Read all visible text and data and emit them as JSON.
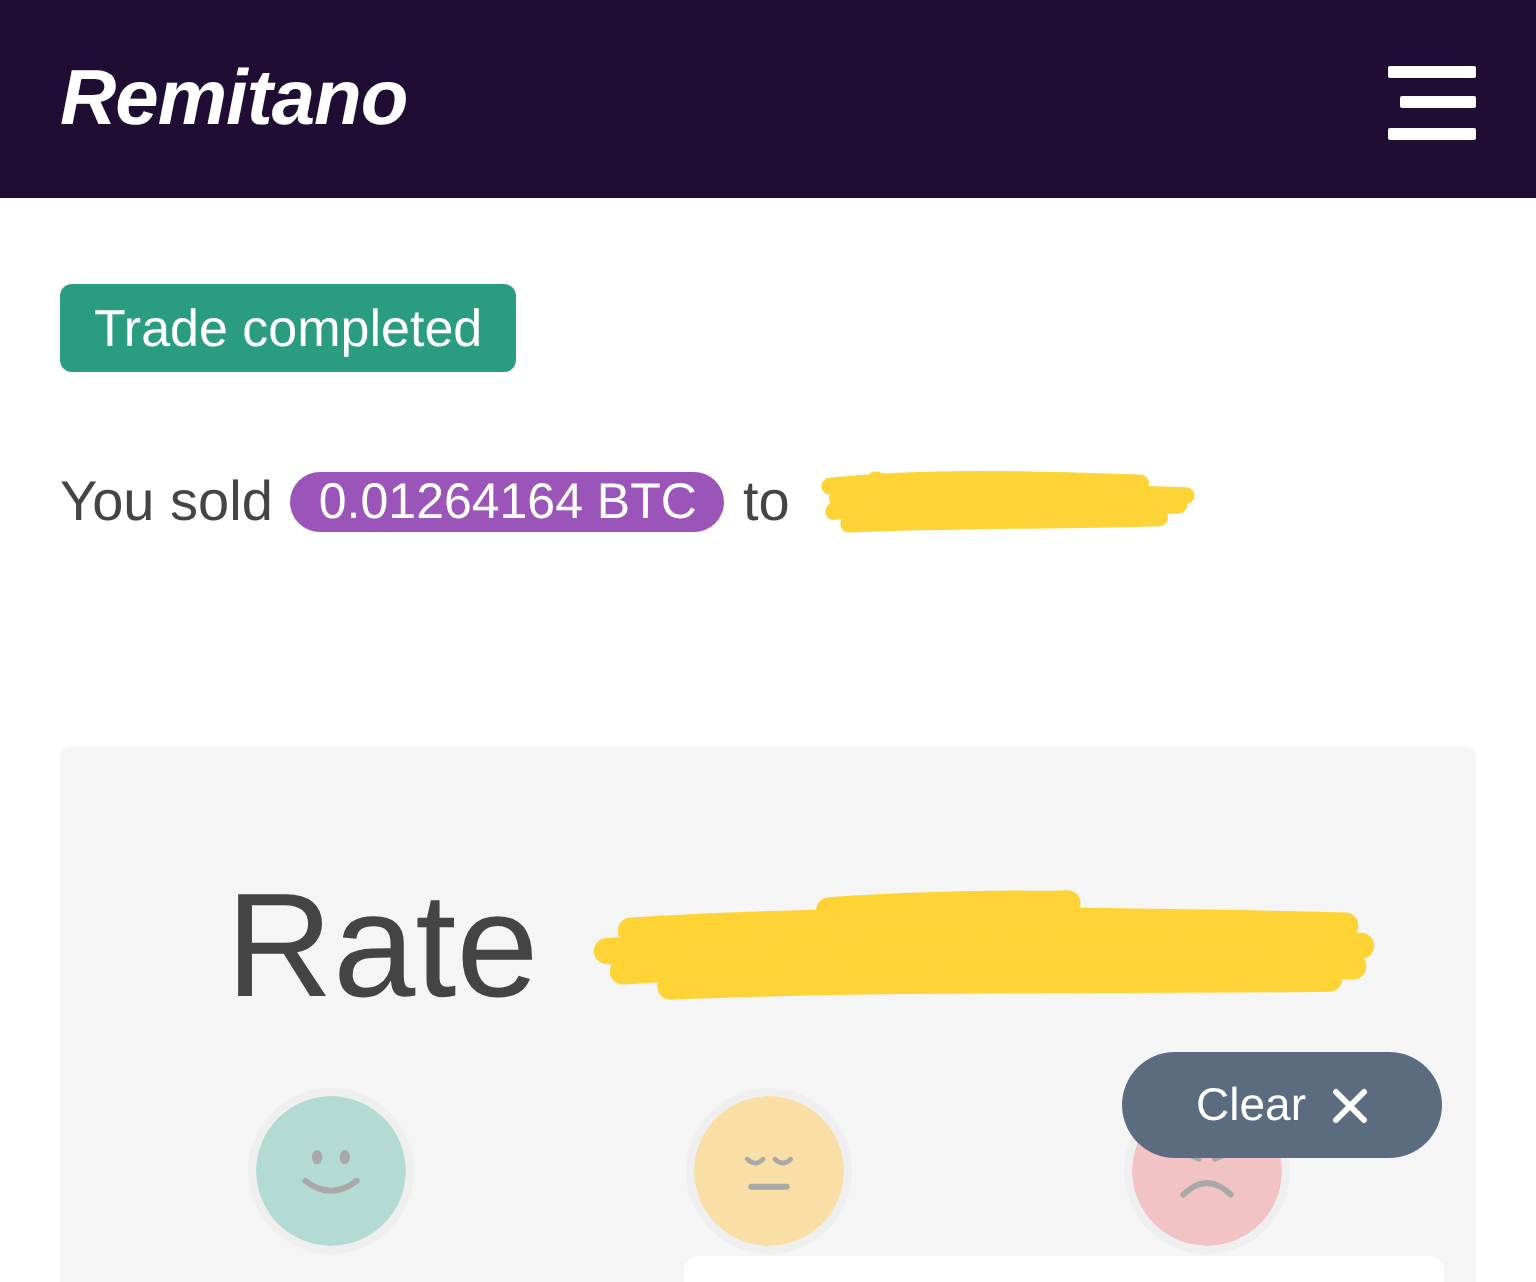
{
  "header": {
    "logo": "Remitano"
  },
  "trade": {
    "status": "Trade completed",
    "lead": "You sold",
    "amount": "0.01264164 BTC",
    "connector": "to",
    "recipient_redacted": true
  },
  "rating": {
    "title": "Rate",
    "subject_redacted": true,
    "options": [
      {
        "kind": "happy",
        "color": "#b3dbd3",
        "selected": false
      },
      {
        "kind": "neutral",
        "color": "#f9dfa6",
        "selected": false
      },
      {
        "kind": "sad",
        "color": "#f2c3c5",
        "selected": false
      }
    ],
    "clear_button": {
      "label": "Clear"
    }
  }
}
